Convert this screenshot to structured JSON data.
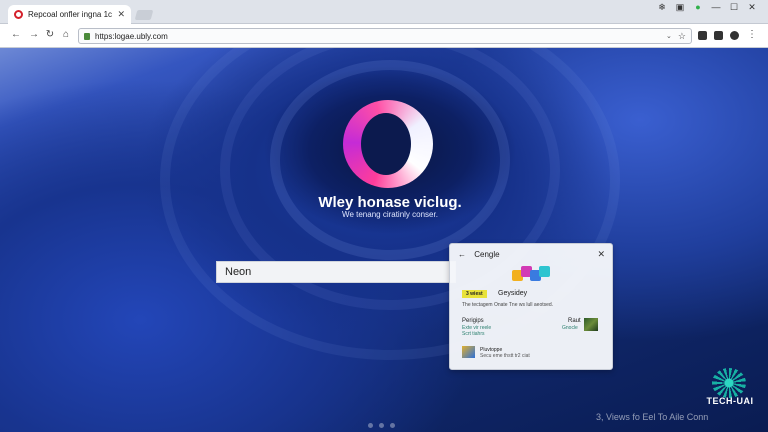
{
  "browser": {
    "tab_title": "Repcoal onfler ingna 1c",
    "tab_close": "✕",
    "url": "https:logae.ubly.com"
  },
  "toolbar": {
    "back": "←",
    "forward": "→",
    "reload": "↻",
    "home": "⌂",
    "dropdown": "⌄",
    "star": "☆"
  },
  "window": {
    "minimize": "—",
    "maximize": "☐",
    "close": "✕",
    "extras": [
      "❄",
      "▣"
    ]
  },
  "hero": {
    "title": "Wley honase viclug.",
    "subtitle": "We tenang ciratinly conser."
  },
  "search": {
    "value": "Neon"
  },
  "panel": {
    "back": "←",
    "title": "Cengle",
    "close": "✕",
    "badge": "3 wiest",
    "badge_title": "Geysidey",
    "description": "The tectagem Onate Tne ws lull aeotsed.",
    "section_left_title": "Perigips",
    "section_left_line1": "Exte vir reele",
    "section_left_line2": "Scrt tiahrs",
    "section_right_title": "Raut",
    "section_right_line1": "Gnocle",
    "item_title": "Pluvtoppe",
    "item_sub": "Secu eme thstt tr2 ciat"
  },
  "watermark": {
    "brand": "TECH-UAI",
    "caption": "3, Views fo Eel To Aile Conn"
  },
  "colors": {
    "accent": "#ff3d9a",
    "wallpaper_base": "#1a3790",
    "badge_yellow": "#e8e23a"
  },
  "icons": [
    "opera-favicon",
    "back-icon",
    "forward-icon",
    "reload-icon",
    "home-icon",
    "lock-icon",
    "star-icon",
    "close-icon",
    "opera-logo-icon"
  ]
}
